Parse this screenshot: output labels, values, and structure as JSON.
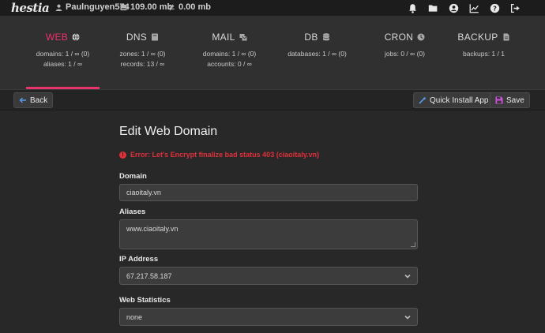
{
  "topbar": {
    "logo": "hestia",
    "user": "Paulnguyen574",
    "disk": "109.00 mb",
    "bandwidth": "0.00 mb",
    "icons": [
      "bell-icon",
      "folder-icon",
      "user-circle-icon",
      "chart-icon",
      "help-icon",
      "logout-icon"
    ]
  },
  "tabs": [
    {
      "title": "WEB",
      "icon": "globe-icon",
      "stats": [
        "domains: 1 / ∞ (0)",
        "aliases: 1 / ∞"
      ],
      "active": true
    },
    {
      "title": "DNS",
      "icon": "book-icon",
      "stats": [
        "zones: 1 / ∞ (0)",
        "records: 13 / ∞"
      ]
    },
    {
      "title": "MAIL",
      "icon": "mail-icon",
      "stats": [
        "domains: 1 / ∞ (0)",
        "accounts: 0 / ∞"
      ]
    },
    {
      "title": "DB",
      "icon": "database-icon",
      "stats": [
        "databases: 1 / ∞ (0)"
      ]
    },
    {
      "title": "CRON",
      "icon": "clock-icon",
      "stats": [
        "jobs: 0 / ∞ (0)"
      ]
    },
    {
      "title": "BACKUP",
      "icon": "file-icon",
      "stats": [
        "backups: 1 / 1"
      ]
    }
  ],
  "toolbar": {
    "back_label": "Back",
    "quick_install_label": "Quick Install App",
    "save_label": "Save"
  },
  "form": {
    "title": "Edit Web Domain",
    "error": "Error: Let's Encrypt finalize bad status 403 (ciaoitaly.vn)",
    "domain_label": "Domain",
    "domain_value": "ciaoitaly.vn",
    "aliases_label": "Aliases",
    "aliases_value": "www.ciaoitaly.vn",
    "ip_label": "IP Address",
    "ip_value": "67.217.58.187",
    "stats_label": "Web Statistics",
    "stats_value": "none"
  },
  "colors": {
    "accent": "#e8336d",
    "error": "#e0303a",
    "save_icon": "#d050e0",
    "link_icon": "#5a9ae8"
  }
}
